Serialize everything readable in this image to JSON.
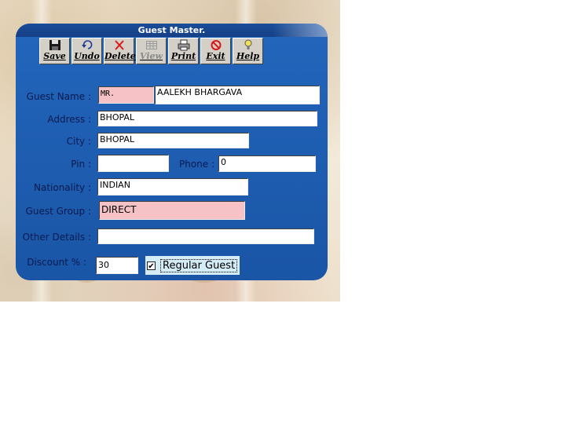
{
  "window": {
    "title": "Guest Master."
  },
  "toolbar": {
    "buttons": [
      {
        "label": "Save",
        "icon": "floppy-disk-icon",
        "enabled": true
      },
      {
        "label": "Undo",
        "icon": "undo-arrow-icon",
        "enabled": true
      },
      {
        "label": "Delete",
        "icon": "red-x-icon",
        "enabled": true
      },
      {
        "label": "View",
        "icon": "grid-icon",
        "enabled": false
      },
      {
        "label": "Print",
        "icon": "printer-icon",
        "enabled": true
      },
      {
        "label": "Exit",
        "icon": "no-entry-icon",
        "enabled": true
      },
      {
        "label": "Help",
        "icon": "question-bulb-icon",
        "enabled": true
      }
    ]
  },
  "form": {
    "guest_name_label": "Guest Name :",
    "title_value": "MR.",
    "name_value": "AALEKH BHARGAVA",
    "address_label": "Address :",
    "address_value": "BHOPAL",
    "city_label": "City :",
    "city_value": "BHOPAL",
    "pin_label": "Pin :",
    "pin_value": "",
    "phone_label": "Phone :",
    "phone_value": "0",
    "nationality_label": "Nationality :",
    "nationality_value": "INDIAN",
    "guest_group_label": "Guest Group :",
    "guest_group_value": "DIRECT",
    "other_details_label": "Other Details :",
    "other_details_value": "",
    "discount_label": "Discount % :",
    "discount_value": "30",
    "regular_guest_label": "Regular Guest",
    "regular_guest_checked": true
  },
  "colors": {
    "window_blue": "#1f5fb3",
    "title_bar": "#163f85",
    "pink_field": "#f6c2c6",
    "label_text": "#0a1a50"
  }
}
